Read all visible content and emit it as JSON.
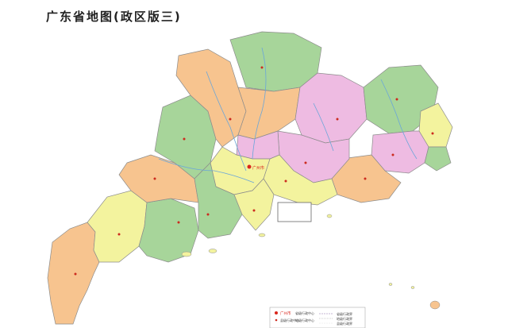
{
  "map": {
    "title": "广东省地图(政区版三)",
    "colors": {
      "green": "#a7d59a",
      "orange": "#f7c48f",
      "pink": "#eebbe2",
      "yellow": "#f3f39e",
      "sea": "#ffffff",
      "border": "#8c8c8c",
      "river": "#6aa6d9",
      "capital": "#d9261c"
    },
    "capital_label": "广州市",
    "legend": {
      "capital": "广州市",
      "capital_note": "省级行政中心",
      "city_note": "地级行政中心",
      "county": "县级行政中心",
      "boundary_1": "省级行政界",
      "boundary_2": "地级行政界",
      "boundary_3": "县级行政界"
    }
  }
}
